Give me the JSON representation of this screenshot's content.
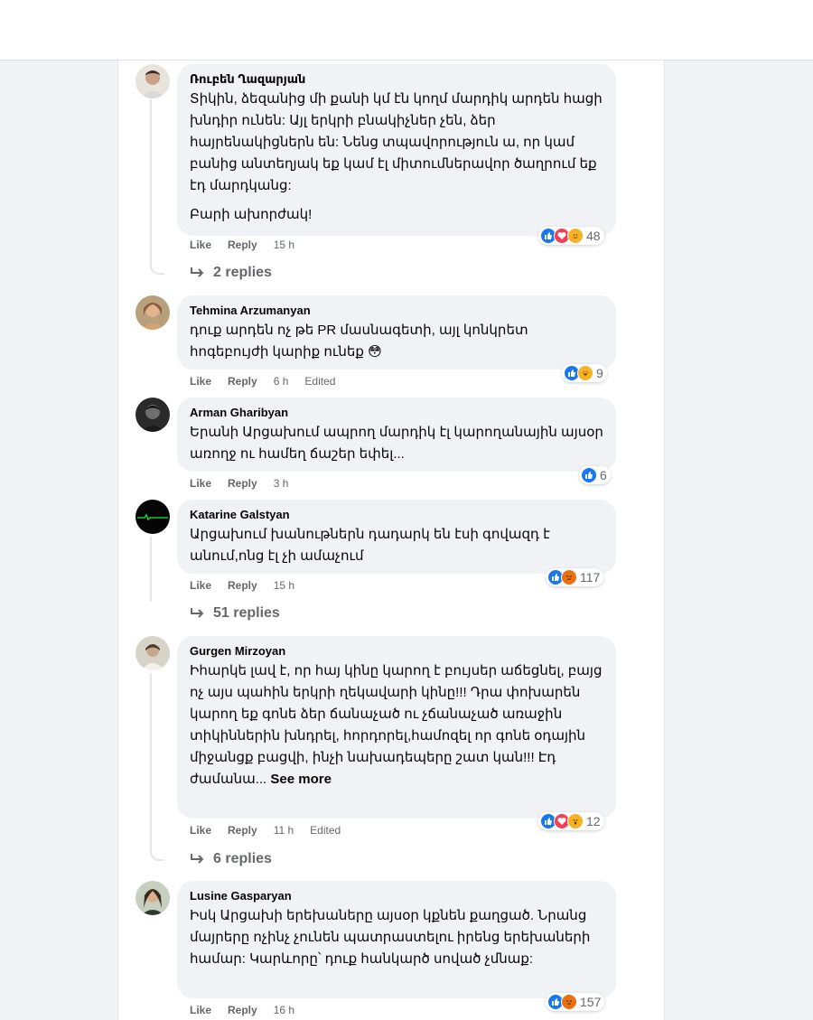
{
  "actions": {
    "like": "Like",
    "reply": "Reply",
    "edited": "Edited",
    "see_more": "See more"
  },
  "comments": [
    {
      "author": "Ռուբեն Ղազարյան",
      "body": [
        "Տիկին, ձեզանից մի քանի կմ էն կողմ մարդիկ արդեն հացի խնդիր ունեն: Այլ երկրի բնակիչներ չեն, ձեր հայրենակիցներն են: Նենց տպավորություն ա, որ կամ բանից անտեղյակ եք կամ էլ միտումներավոր ծաղրում եք էդ մարդկանց:",
        "Բարի ախորժակ!"
      ],
      "time": "15 h",
      "reactions": [
        "like",
        "love",
        "care"
      ],
      "reaction_count": "48",
      "replies": "2 replies"
    },
    {
      "author": "Tehmina Arzumanyan",
      "body": [
        "դուք արդեն ոչ թե PR մասնագետի, այլ կոնկրետ հոգեբույժի կարիք ունեք 😳"
      ],
      "time": "6 h",
      "edited": true,
      "reactions": [
        "like",
        "haha"
      ],
      "reaction_count": "9"
    },
    {
      "author": "Arman Gharibyan",
      "body": [
        "Երանի Արցախում ապրող մարդիկ էլ կարողանային այսօր առողջ ու համեղ ճաշեր եփել..."
      ],
      "time": "3 h",
      "reactions": [
        "like"
      ],
      "reaction_count": "6"
    },
    {
      "author": "Katarine Galstyan",
      "body": [
        "Արցախում խանութներն դադարկ են էսի գովազդ է անում,ոնց էլ չի ամաչում"
      ],
      "time": "15 h",
      "reactions": [
        "like",
        "angry"
      ],
      "reaction_count": "117",
      "replies": "51 replies"
    },
    {
      "author": "Gurgen Mirzoyan",
      "body": [
        "Իհարկե լավ է, որ հայ կինը կարող է բույսեր աճեցնել, բայց ոչ այս պահին երկրի ղեկավարի կինը!!! Դրա փոխարեն կարող եք գոնե ձեր ճանաչած ու չճանաչած առաջին տիկիններին խնդրել, հորդորել,համոզել որ գոնե օդային միջանցք բացվի, ինչի նախադեպերը շատ կան!!! Էդ ժամանա..."
      ],
      "see_more": true,
      "time": "11 h",
      "edited": true,
      "reactions": [
        "like",
        "love",
        "wow"
      ],
      "reaction_count": "12",
      "replies": "6 replies"
    },
    {
      "author": "Lusine Gasparyan",
      "body": [
        "Իսկ Արցախի երեխաները այսօր կքնեն քաղցած. Նրանց մայրերը ոչինչ չունեն պատրաստելու իրենց երեխաների համար: Կարևորը՝ դուք հանկարծ սոված չմնաք:"
      ],
      "time": "16 h",
      "reactions": [
        "like",
        "angry"
      ],
      "reaction_count": "157"
    }
  ],
  "colors": {
    "like": "#1877f2",
    "love": "#f33e58",
    "haha": "#f7b125",
    "angry": "#e9710f",
    "meta_text": "#65676b",
    "bubble": "#f0f2f5"
  }
}
